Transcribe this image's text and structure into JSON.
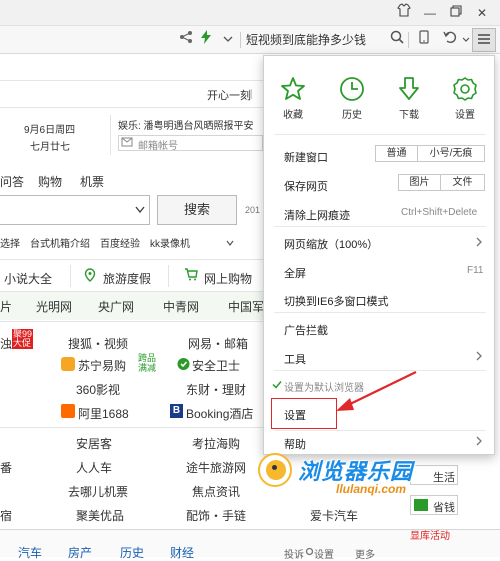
{
  "toolbar": {
    "search_text": "短视频到底能挣多少钱"
  },
  "page": {
    "top_link": "开心一刻",
    "date": "9月6日周四",
    "lunar": "七月廿七",
    "news_headline": "娱乐: 潘粤明遇台风晒照报平安",
    "email_placeholder": "邮箱帐号",
    "nav_tabs": [
      "问答",
      "购物",
      "机票"
    ],
    "search_button": "搜索",
    "year_hint": "201",
    "quick_links": [
      "选择",
      "台式机箱介绍",
      "百度经验",
      "kk录像机"
    ],
    "shortcuts": [
      "小说大全",
      "旅游度假",
      "网上购物"
    ],
    "sites_row": [
      "片",
      "光明网",
      "央广网",
      "中青网",
      "中国军网"
    ],
    "sites": [
      "浊",
      "搜狐・视频",
      "网易・邮箱",
      "苏宁易购",
      "安全卫士",
      "360影视",
      "东财・理财",
      "阿里1688",
      "Booking酒店",
      "安居客",
      "考拉海购",
      "番",
      "人人车",
      "途牛旅游网",
      "去哪儿机票",
      "焦点资讯",
      "宿",
      "聚美优品",
      "配饰・手链",
      "爱卡汽车"
    ],
    "promo1": "聚99\n大促",
    "promo2": "跨品\n满减",
    "bottom_tabs": [
      "汽车",
      "房产",
      "历史",
      "财经"
    ],
    "footer_links": [
      "投诉",
      "设置",
      "更多"
    ],
    "side_btn1": "生活",
    "side_btn2": "省钱",
    "side_btn3": "显库活动"
  },
  "menu": {
    "icons": [
      {
        "label": "收藏",
        "icon": "star-icon"
      },
      {
        "label": "历史",
        "icon": "clock-icon"
      },
      {
        "label": "下载",
        "icon": "download-icon"
      },
      {
        "label": "设置",
        "icon": "gear-icon"
      }
    ],
    "new_window": "新建窗口",
    "new_window_normal": "普通",
    "new_window_private": "小号/无痕",
    "save_page": "保存网页",
    "save_image": "图片",
    "save_file": "文件",
    "clear_history": "清除上网痕迹",
    "clear_shortcut": "Ctrl+Shift+Delete",
    "zoom": "网页缩放（100%）",
    "fullscreen": "全屏",
    "fullscreen_key": "F11",
    "ie6_mode": "切换到IE6多窗口模式",
    "ad_block": "广告拦截",
    "tools": "工具",
    "default_browser": "设置为默认浏览器",
    "settings": "设置",
    "help": "帮助"
  },
  "watermark": {
    "line1": "浏览器乐园",
    "line2": "llulanqi.com"
  },
  "colors": {
    "accent_green": "#2a9a2a",
    "annotation_red": "#e0282a",
    "watermark_blue": "#1a8be6"
  }
}
